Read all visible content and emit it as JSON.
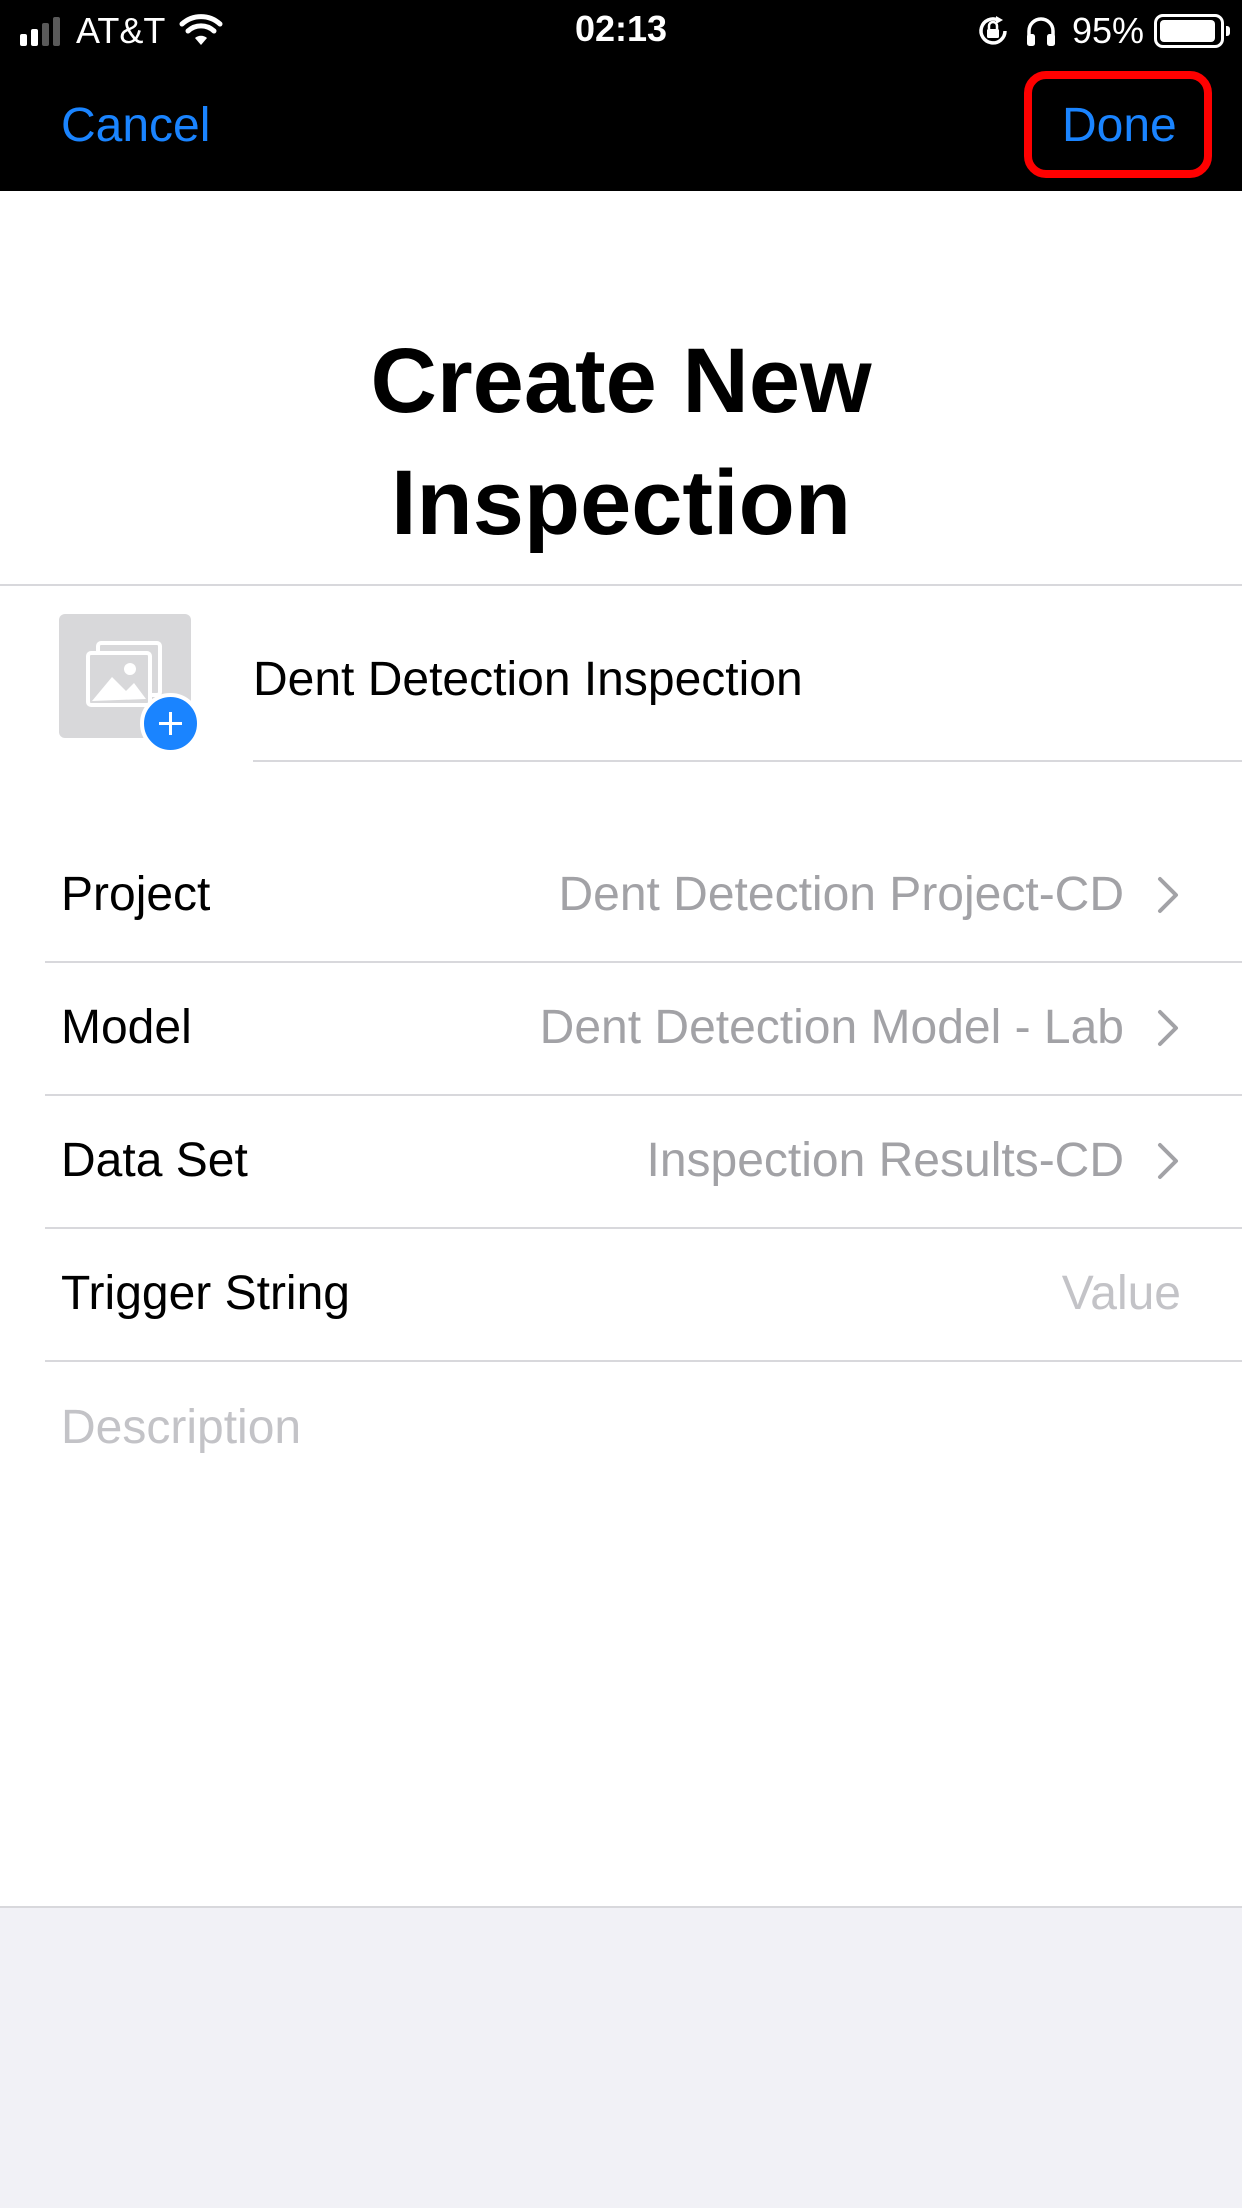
{
  "status_bar": {
    "carrier": "AT&T",
    "time": "02:13",
    "battery_percent": "95%",
    "battery_level": 0.95,
    "signal_bars_active": 2,
    "icons": [
      "signal-icon",
      "wifi-icon",
      "orientation-lock-icon",
      "headphones-icon",
      "battery-icon"
    ]
  },
  "nav": {
    "cancel_label": "Cancel",
    "done_label": "Done",
    "done_highlight_color": "#ff0000"
  },
  "page": {
    "title_line1": "Create New",
    "title_line2": "Inspection"
  },
  "inspection": {
    "name_value": "Dent Detection Inspection"
  },
  "form": {
    "rows": [
      {
        "label": "Project",
        "value": "Dent Detection Project-CD"
      },
      {
        "label": "Model",
        "value": "Dent Detection Model - Lab"
      },
      {
        "label": "Data Set",
        "value": "Inspection Results-CD"
      },
      {
        "label": "Trigger String",
        "placeholder": "Value"
      }
    ],
    "description_placeholder": "Description"
  },
  "colors": {
    "accent": "#1a84ff",
    "secondary_text": "#a2a2a6",
    "placeholder_text": "#c3c3c7",
    "grouped_background": "#f1f1f6"
  }
}
